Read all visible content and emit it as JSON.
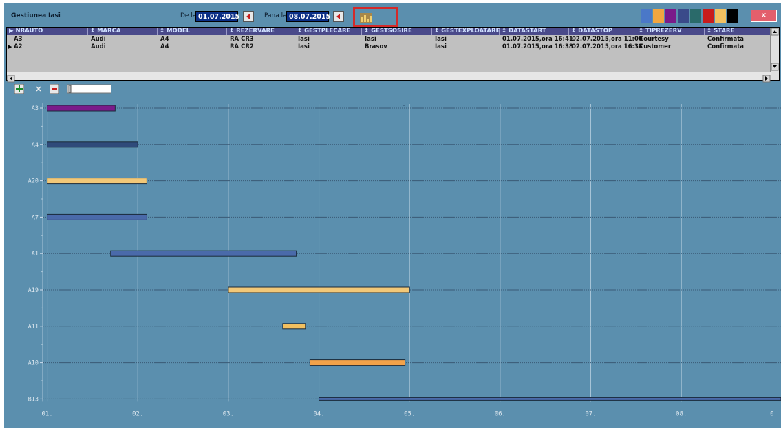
{
  "toolbar": {
    "gestiunea_label": "Gestiunea",
    "gestiunea_value": "Iasi",
    "dela_label": "De la",
    "dela_value": "01.07.2015",
    "pana_label": "Pana la",
    "pana_value": "08.07.2015",
    "chart_button_icon": "bar-chart-icon",
    "color_swatches": [
      "#4a78c8",
      "#f2a640",
      "#7a1a8a",
      "#3a4a8a",
      "#2a6a6a",
      "#c81c1c",
      "#f2c060",
      "#000000"
    ],
    "close_label": "×"
  },
  "table": {
    "columns": [
      "NRAUTO",
      "MARCA",
      "MODEL",
      "REZERVARE",
      "GESTPLECARE",
      "GESTSOSIRE",
      "GESTEXPLOATARE",
      "DATASTART",
      "DATASTOP",
      "TIPREZERV",
      "STARE"
    ],
    "rows": [
      [
        "A3",
        "Audi",
        "A4",
        "RA CR3",
        "Iasi",
        "Iasi",
        "Iasi",
        "01.07.2015,ora 16:41",
        "02.07.2015,ora 11:00",
        "Courtesy",
        "Confirmata"
      ],
      [
        "A2",
        "Audi",
        "A4",
        "RA CR2",
        "Iasi",
        "Brasov",
        "Iasi",
        "01.07.2015,ora 16:38",
        "02.07.2015,ora 16:38",
        "Customer",
        "Confirmata"
      ]
    ]
  },
  "zoom_controls": {
    "add_icon": "plus-icon",
    "remove_icon": "x-icon",
    "minus_icon": "minus-icon"
  },
  "chart_data": {
    "type": "gantt",
    "x_ticks": [
      "01.",
      "02.",
      "03.",
      "04.",
      "05.",
      "06.",
      "07.",
      "08.",
      "0"
    ],
    "x_range": [
      0.95,
      9.1
    ],
    "rows": [
      "A3",
      "A4",
      "A20",
      "A7",
      "A1",
      "A19",
      "A11",
      "A10",
      "B13"
    ],
    "bars": [
      {
        "row": "A3",
        "start": 1.0,
        "end": 1.75,
        "color": "#7a1a8a"
      },
      {
        "row": "A4",
        "start": 1.0,
        "end": 2.0,
        "color": "#2f4a7a"
      },
      {
        "row": "A20",
        "start": 1.0,
        "end": 2.1,
        "color": "#f2c878"
      },
      {
        "row": "A7",
        "start": 1.0,
        "end": 2.1,
        "color": "#4a6aaa"
      },
      {
        "row": "A1",
        "start": 1.7,
        "end": 3.75,
        "color": "#4a6aaa"
      },
      {
        "row": "A19",
        "start": 3.0,
        "end": 5.0,
        "color": "#f2c878"
      },
      {
        "row": "A11",
        "start": 3.6,
        "end": 3.85,
        "color": "#f2c060"
      },
      {
        "row": "A10",
        "start": 3.9,
        "end": 4.95,
        "color": "#f2a24a"
      },
      {
        "row": "B13",
        "start": 4.0,
        "end": 9.1,
        "color": "#4a6aaa"
      }
    ],
    "grid": true
  }
}
